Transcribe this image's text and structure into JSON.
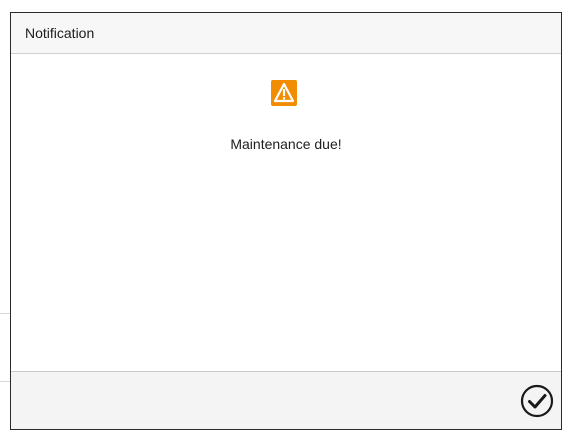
{
  "dialog": {
    "title": "Notification",
    "icon": "warning-icon",
    "message": "Maintenance due!",
    "confirm_icon": "checkmark-circle-icon"
  },
  "colors": {
    "warning": "#f28c00",
    "border": "#2a2a2a",
    "header_bg": "#f7f7f7",
    "footer_bg": "#f4f4f4"
  }
}
